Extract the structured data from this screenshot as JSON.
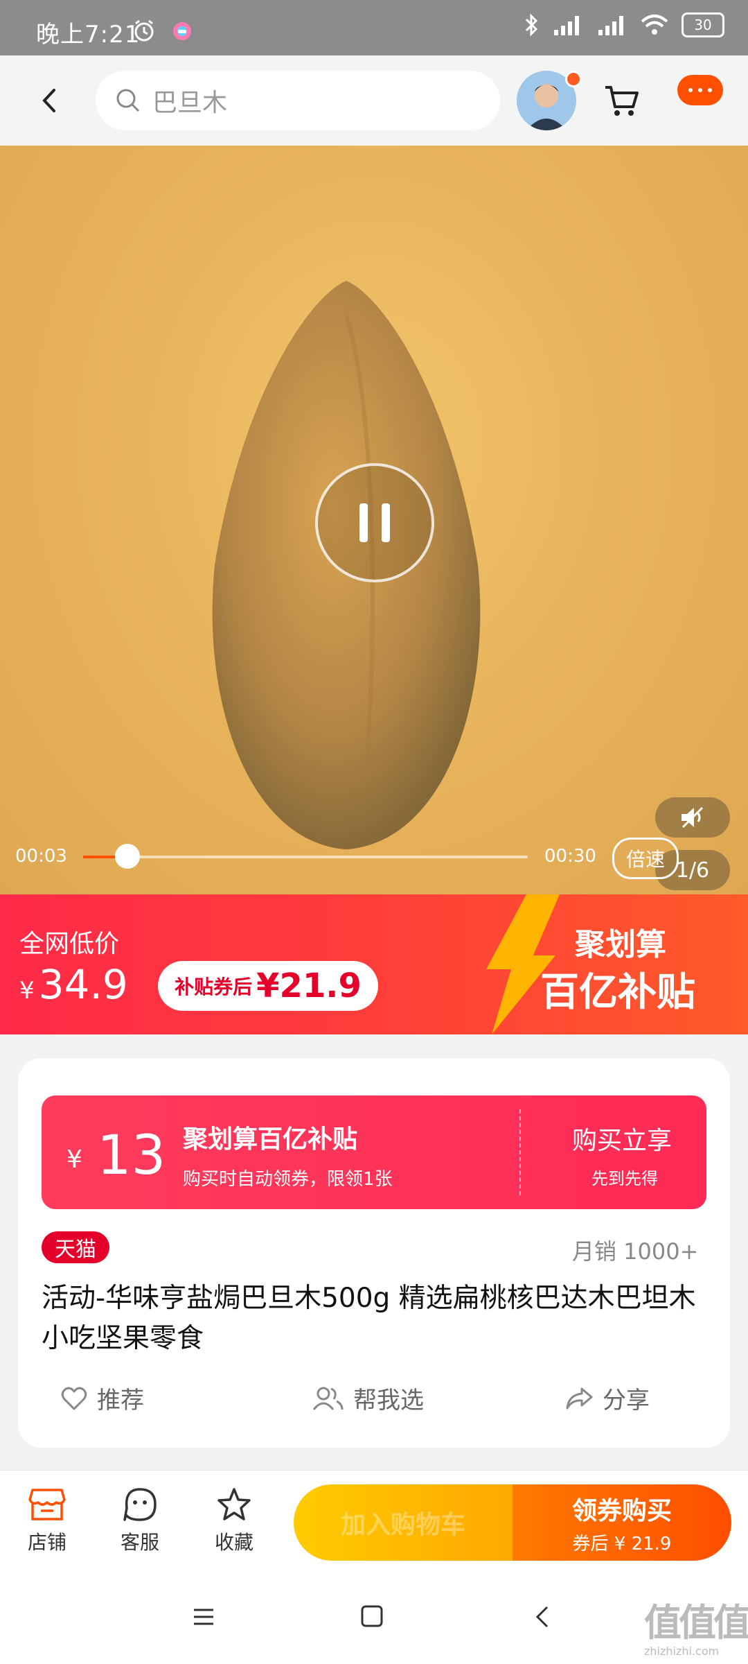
{
  "status_bar": {
    "time": "晚上7:21",
    "battery": "30"
  },
  "search": {
    "value": "巴旦木"
  },
  "video": {
    "current_time": "00:03",
    "total_time": "00:30",
    "progress_fraction": 0.1,
    "speed_label": "倍速",
    "page_indicator": "1/6"
  },
  "price_band": {
    "label": "全网低价",
    "currency": "¥",
    "price": "34.9",
    "coupon_label": "补贴券后",
    "coupon_price": "¥21.9",
    "brand_line1": "聚划算",
    "brand_line2": "百亿补贴"
  },
  "coupon": {
    "currency": "¥",
    "amount": "13",
    "title": "聚划算百亿补贴",
    "subtitle": "购买时自动领券，限领1张",
    "action": "购买立享",
    "note": "先到先得"
  },
  "product": {
    "badge": "天猫",
    "sales": "月销 1000+",
    "title": "活动-华味亨盐焗巴旦木500g 精选扁桃核巴达木巴坦木小吃坚果零食"
  },
  "actions": {
    "recommend": "推荐",
    "help_choose": "帮我选",
    "share": "分享"
  },
  "bottom_bar": {
    "store": "店铺",
    "service": "客服",
    "favorite": "收藏",
    "add_cart": "加入购物车",
    "buy": "领券购买",
    "buy_sub": "券后 ¥ 21.9"
  },
  "watermark": {
    "text": "值值值",
    "url": "zhizhizhi.com"
  },
  "colors": {
    "accent": "#ff5000",
    "red": "#ff2a48",
    "tmall": "#e4002b"
  }
}
